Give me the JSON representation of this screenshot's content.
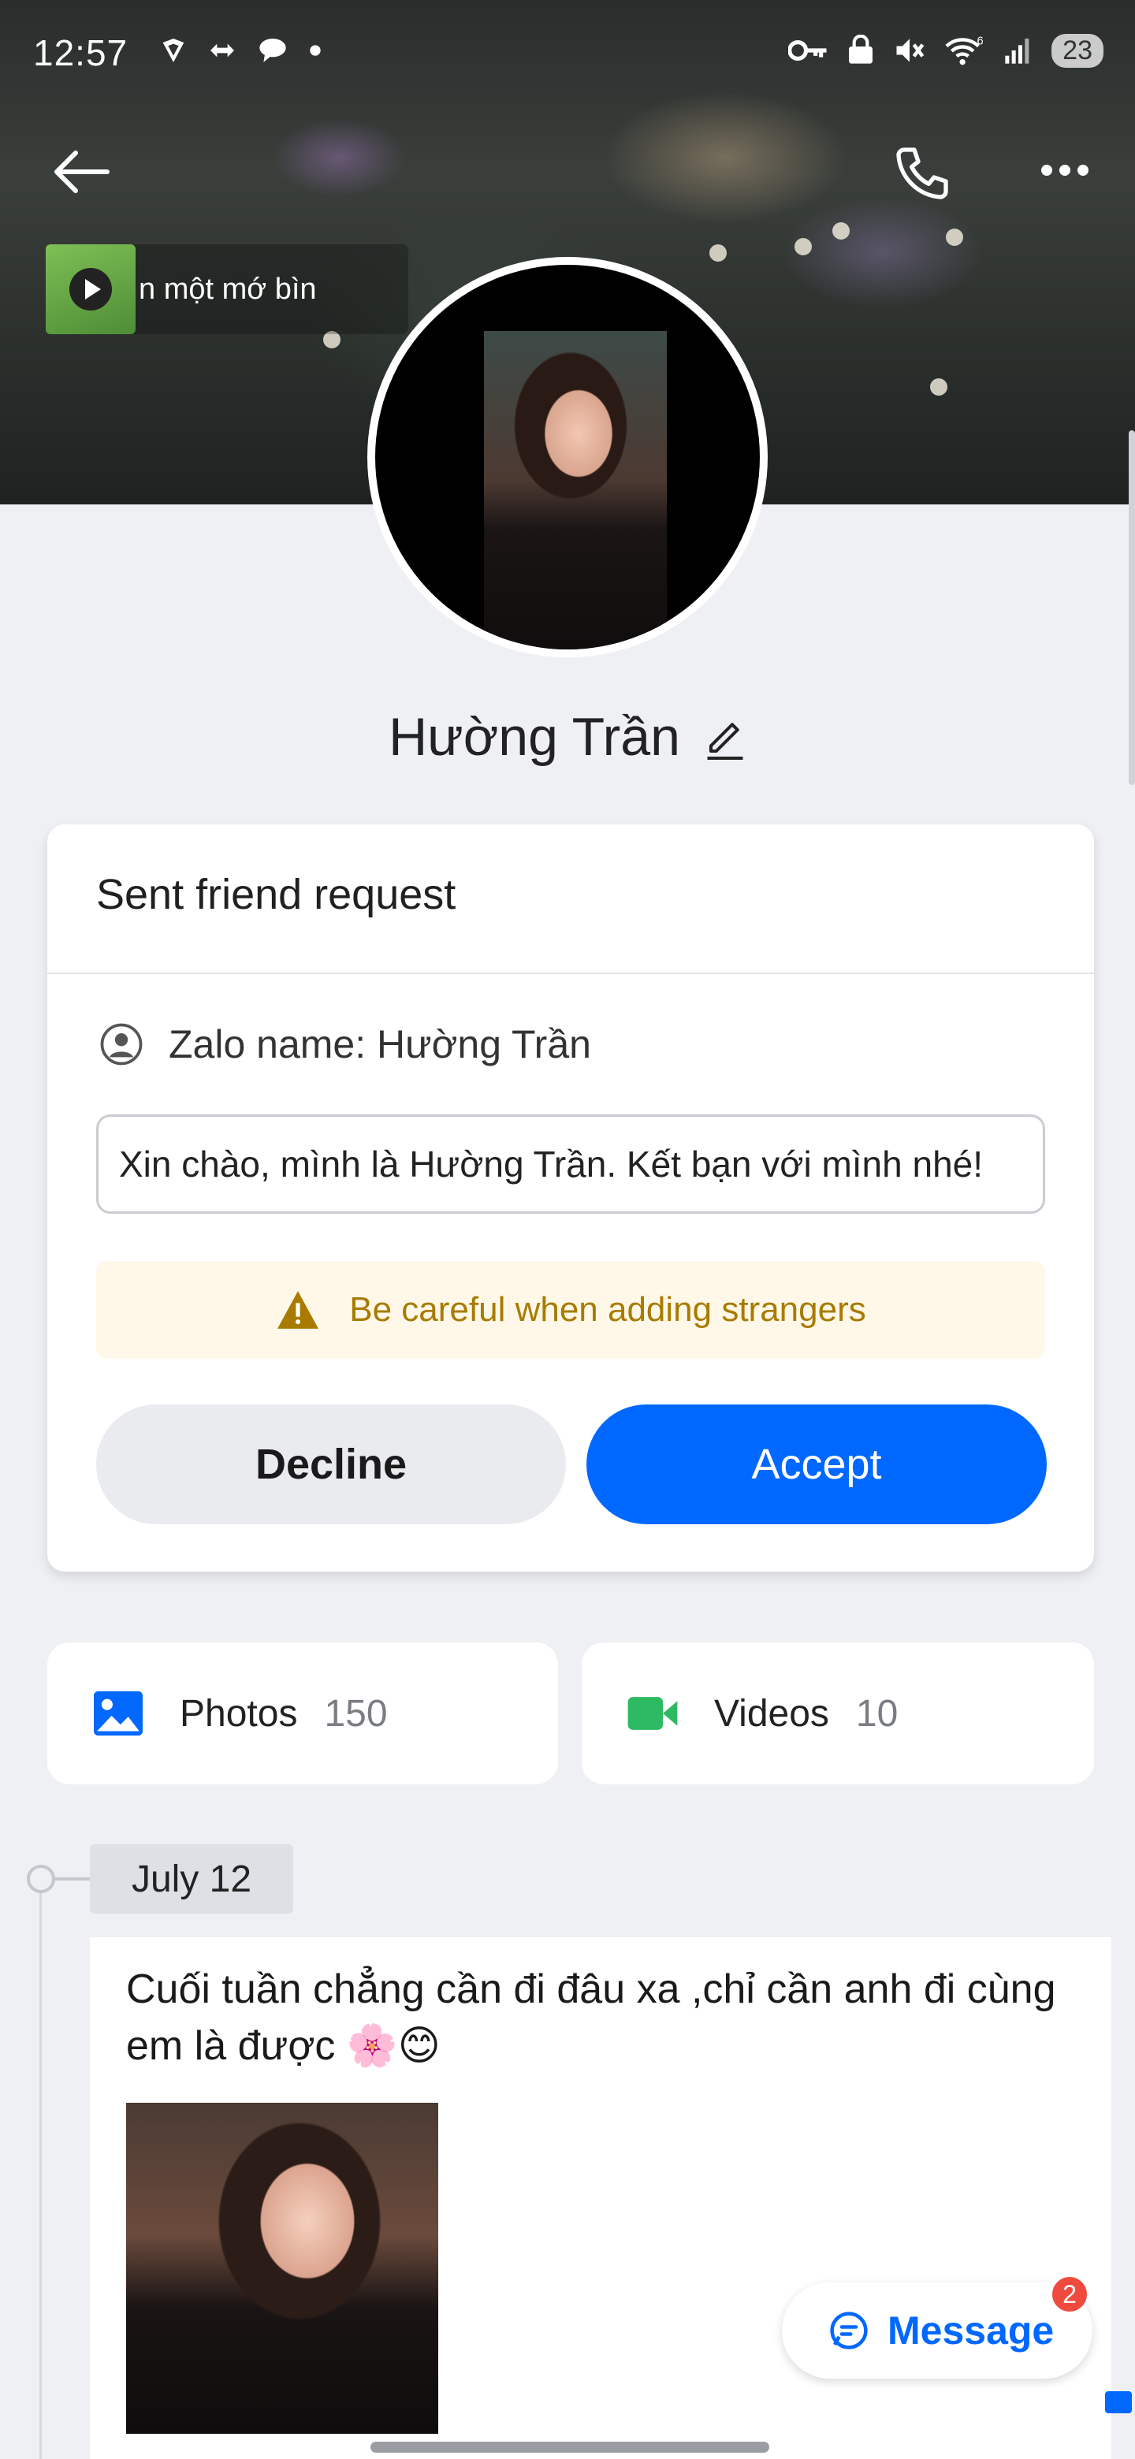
{
  "status_bar": {
    "time": "12:57",
    "battery": "23",
    "left_icons": [
      "vpn-shield-icon",
      "data-transfer-icon",
      "chat-bubble-icon",
      "dot-icon"
    ],
    "right_icons": [
      "key-icon",
      "lock-icon",
      "muted-icon",
      "wifi-6-icon",
      "signal-icon"
    ]
  },
  "header": {
    "back_icon": "arrow-left-icon",
    "call_icon": "phone-icon",
    "more_icon": "more-dots-icon",
    "music_text": "n một mớ bìn"
  },
  "profile": {
    "name": "Hường Trần"
  },
  "friend_request": {
    "title": "Sent friend request",
    "zalo_name": "Zalo name: Hường Trần",
    "greeting": "Xin chào, mình là Hường Trần. Kết bạn với mình nhé!",
    "warning": "Be careful when adding strangers",
    "decline_label": "Decline",
    "accept_label": "Accept"
  },
  "media": {
    "photos_label": "Photos",
    "photos_count": "150",
    "videos_label": "Videos",
    "videos_count": "10"
  },
  "timeline": {
    "date": "July 12",
    "post_text": "Cuối tuần chẳng cần đi đâu xa ,chỉ cần anh đi cùng em là được 🌸😊"
  },
  "message_button": {
    "label": "Message",
    "badge": "2"
  },
  "colors": {
    "accent": "#0068ff",
    "warning_text": "#a87b00",
    "warning_bg": "#fff8e8",
    "badge": "#f04a3e",
    "videos_icon": "#2dba62"
  }
}
